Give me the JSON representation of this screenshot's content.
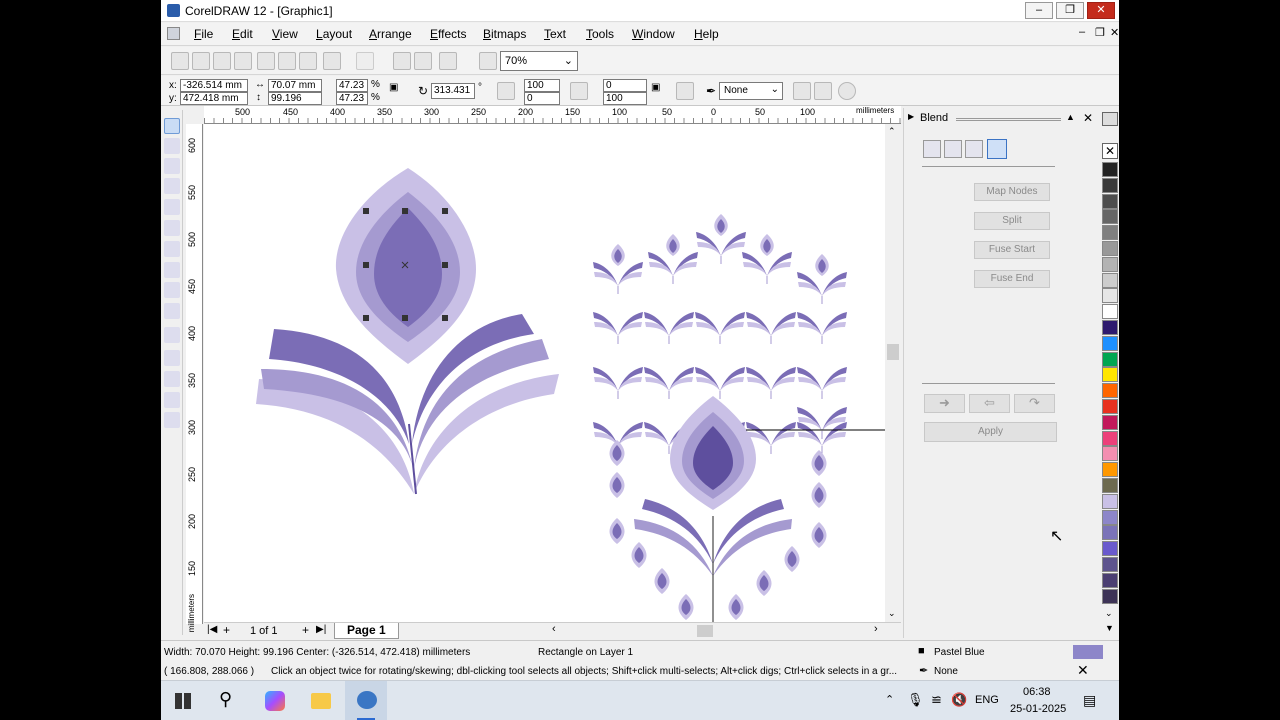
{
  "window": {
    "title": "CorelDRAW 12 - [Graphic1]",
    "controls": [
      "minimize",
      "restore",
      "close"
    ]
  },
  "menu": [
    "File",
    "Edit",
    "View",
    "Layout",
    "Arrange",
    "Effects",
    "Bitmaps",
    "Text",
    "Tools",
    "Window",
    "Help"
  ],
  "toolbar": {
    "zoom": "70%"
  },
  "property_bar": {
    "x": "-326.514 mm",
    "y": "472.418 mm",
    "width": "70.07 mm",
    "height": "99.196 mm",
    "scale_x": "47.23",
    "scale_y": "47.23",
    "percent": "%",
    "rotation": "313.431",
    "degree": "°",
    "corner_a": "100",
    "corner_b": "0",
    "corner_c": "0",
    "corner_d": "100",
    "outline": "None"
  },
  "ruler": {
    "h_ticks": [
      "500",
      "450",
      "400",
      "350",
      "300",
      "250",
      "200",
      "150",
      "100",
      "50",
      "0",
      "50",
      "100"
    ],
    "h_unit": "millimeters",
    "v_ticks": [
      "600",
      "550",
      "500",
      "450",
      "400",
      "350",
      "300",
      "250",
      "200",
      "150"
    ],
    "v_unit": "millimeters"
  },
  "pages": {
    "counter": "1 of 1",
    "tab": "Page 1"
  },
  "docker": {
    "title": "Blend",
    "buttons": [
      "Map Nodes",
      "Split",
      "Fuse Start",
      "Fuse End"
    ],
    "apply": "Apply"
  },
  "palette": {
    "colors": [
      "#222222",
      "#3a3a3a",
      "#4d4d4d",
      "#666666",
      "#7f7f7f",
      "#999999",
      "#b3b3b3",
      "#cccccc",
      "#e6e6e6",
      "#ffffff",
      "#2e1a6e",
      "#1e90ff",
      "#00a651",
      "#ffe600",
      "#ff6600",
      "#e8311f",
      "#c2185b",
      "#ec407a",
      "#f48fb1",
      "#ff9800",
      "#6d6a4f",
      "#c9c0e6",
      "#8d86c9",
      "#7b73b8",
      "#6a5acd",
      "#5e548e",
      "#4b3f72",
      "#3d3356"
    ]
  },
  "status": {
    "dims": "Width: 70.070  Height: 99.196  Center: (-326.514, 472.418)  millimeters",
    "object": "Rectangle on Layer 1",
    "coords": "( 166.808, 288.066 )",
    "hint": "Click an object twice for rotating/skewing; dbl-clicking tool selects all objects; Shift+click multi-selects; Alt+click digs; Ctrl+click selects in a gr...",
    "fill": "Pastel Blue",
    "fill_color": "#8d86c9",
    "outline": "None"
  },
  "taskbar": {
    "lang": "ENG",
    "time": "06:38",
    "date": "25-01-2025"
  },
  "art_colors": {
    "light": "#c9c0e6",
    "mid": "#a59ad0",
    "dark": "#7b6db6",
    "deep": "#5e4f9e"
  }
}
